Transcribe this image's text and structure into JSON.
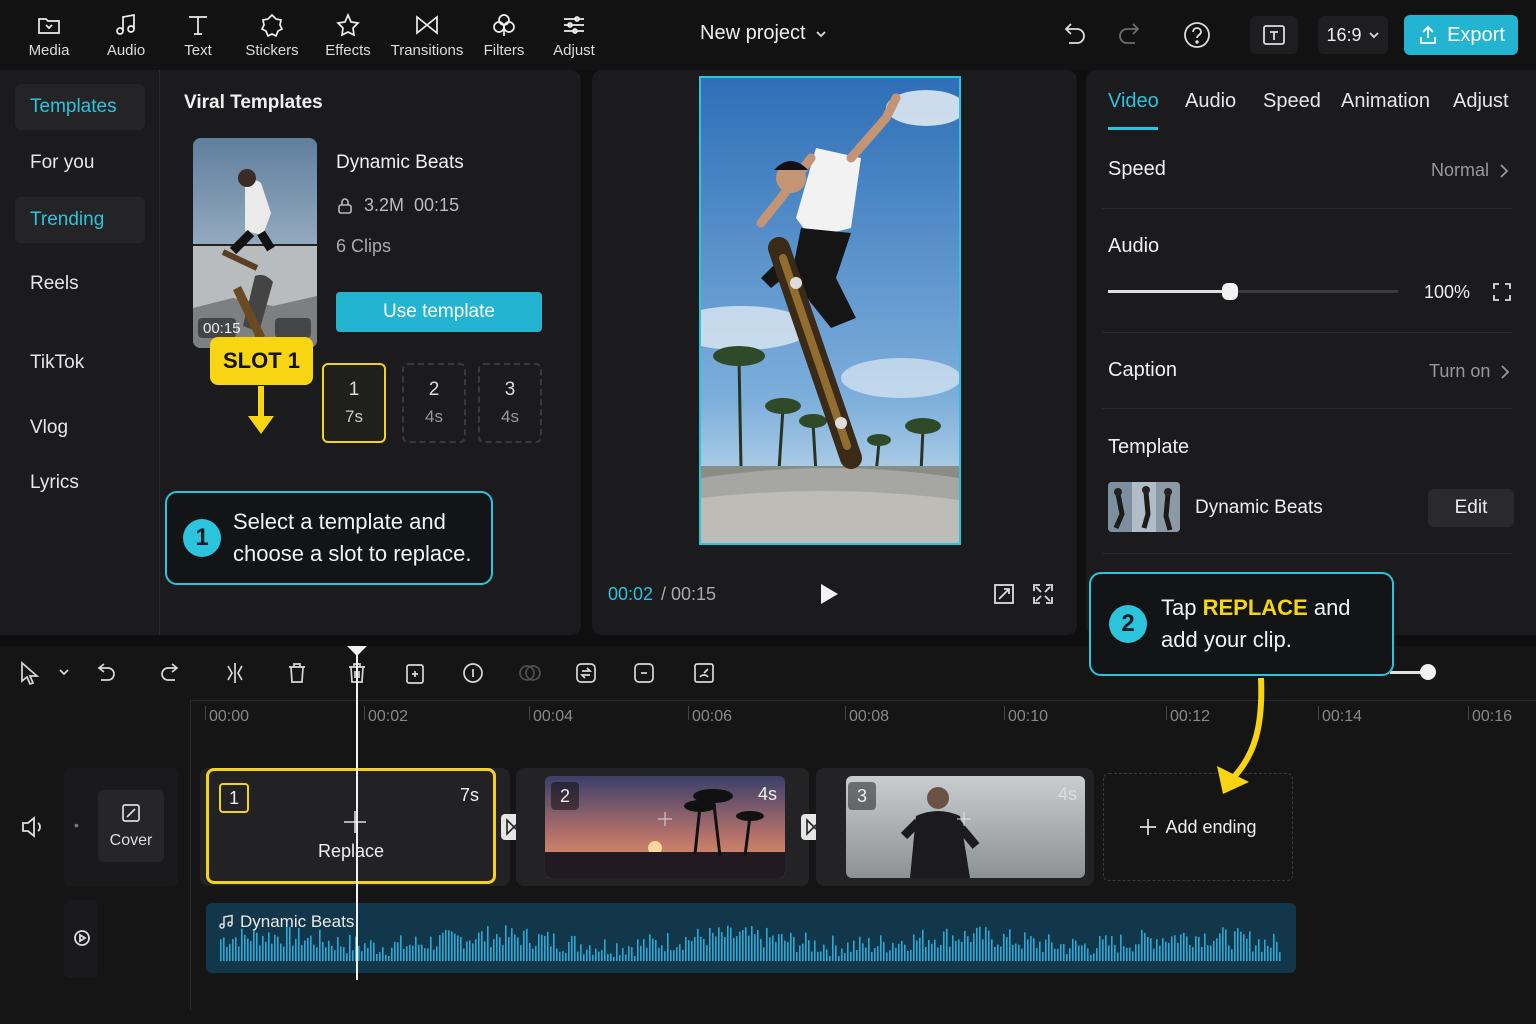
{
  "toolbar": {
    "tools": [
      {
        "label": "Media",
        "icon": "folder-icon"
      },
      {
        "label": "Audio",
        "icon": "music-note-icon"
      },
      {
        "label": "Text",
        "icon": "text-t-icon"
      },
      {
        "label": "Stickers",
        "icon": "sticker-icon"
      },
      {
        "label": "Effects",
        "icon": "star-icon"
      },
      {
        "label": "Transitions",
        "icon": "bowtie-icon"
      },
      {
        "label": "Filters",
        "icon": "clover-icon"
      },
      {
        "label": "Adjust",
        "icon": "sliders-icon"
      }
    ],
    "project_title": "New project",
    "ratio": "16:9",
    "export_label": "Export"
  },
  "categories": [
    {
      "label": "Templates",
      "active": true
    },
    {
      "label": "For you",
      "active": false
    },
    {
      "label": "Trending",
      "active": true
    },
    {
      "label": "Reels",
      "active": false
    },
    {
      "label": "TikTok",
      "active": false
    },
    {
      "label": "Vlog",
      "active": false
    },
    {
      "label": "Lyrics",
      "active": false
    }
  ],
  "templates": {
    "section_title": "Viral Templates",
    "card": {
      "name": "Dynamic Beats",
      "likes": "3.2M",
      "duration": "00:15",
      "clips": "6 Clips",
      "thumb_time": "00:15",
      "use_label": "Use template"
    },
    "slots": [
      {
        "num": "1",
        "dur": "7s",
        "selected": true
      },
      {
        "num": "2",
        "dur": "4s",
        "selected": false
      },
      {
        "num": "3",
        "dur": "4s",
        "selected": false
      }
    ],
    "slot_badge": "SLOT 1"
  },
  "callouts": {
    "one": {
      "num": "1",
      "line1": "Select a template and",
      "line2": "choose a slot to replace."
    },
    "two": {
      "num": "2",
      "pre": "Tap ",
      "highlight": "REPLACE",
      "post": " and",
      "line2": "add your clip."
    }
  },
  "preview": {
    "current_time": "00:02",
    "total_time": "/ 00:15"
  },
  "properties": {
    "tabs": [
      "Video",
      "Audio",
      "Speed",
      "Animation",
      "Adjust"
    ],
    "active_tab": "Video",
    "speed_label": "Speed",
    "speed_value": "Normal",
    "audio_label": "Audio",
    "audio_volume": "100%",
    "audio_fraction": 0.42,
    "caption_label": "Caption",
    "caption_value": "Turn on",
    "template_label": "Template",
    "template_name": "Dynamic Beats",
    "edit_label": "Edit"
  },
  "timeline": {
    "ruler": [
      "00:00",
      "00:02",
      "00:04",
      "00:06",
      "00:08",
      "00:10",
      "00:12",
      "00:14",
      "00:16"
    ],
    "cover_label": "Cover",
    "clips": [
      {
        "num": "1",
        "dur": "7s",
        "action": "Replace"
      },
      {
        "num": "2",
        "dur": "4s"
      },
      {
        "num": "3",
        "dur": "4s"
      }
    ],
    "add_ending": "Add ending",
    "audio_name": "Dynamic Beats"
  },
  "colors": {
    "accent": "#2cc3dc",
    "highlight": "#f7d512",
    "export": "#22b4d0"
  }
}
